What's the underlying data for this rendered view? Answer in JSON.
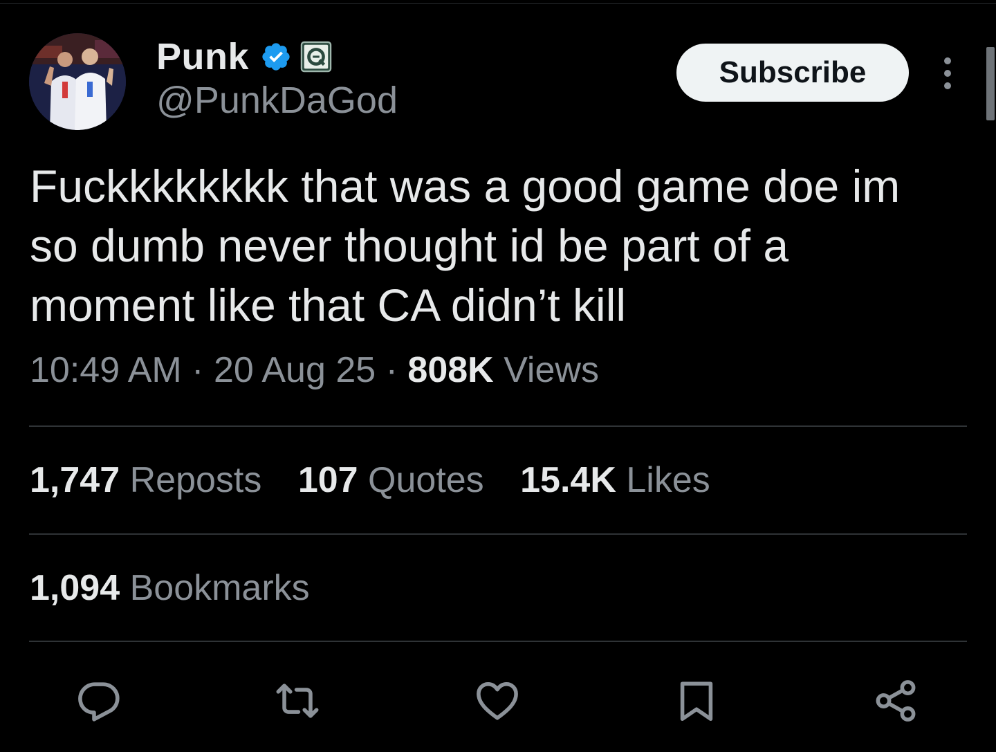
{
  "author": {
    "display_name": "Punk",
    "handle": "@PunkDaGod"
  },
  "header": {
    "subscribe_label": "Subscribe"
  },
  "tweet": {
    "text": "Fuckkkkkkkk that was a good game doe im so dumb never thought id be part of a moment like that CA didn’t kill",
    "time": "10:49 AM",
    "date": "20 Aug 25",
    "views_count": "808K",
    "views_label": "Views",
    "separator": "·"
  },
  "stats": {
    "reposts_count": "1,747",
    "reposts_label": "Reposts",
    "quotes_count": "107",
    "quotes_label": "Quotes",
    "likes_count": "15.4K",
    "likes_label": "Likes",
    "bookmarks_count": "1,094",
    "bookmarks_label": "Bookmarks"
  },
  "colors": {
    "background": "#000000",
    "text_primary": "#e7e9ea",
    "text_secondary": "#8b9198",
    "verified_blue": "#1d9bf0",
    "divider": "#2f3336"
  },
  "icons": {
    "verified": "verified-badge-icon",
    "affiliate": "affiliate-badge-icon",
    "more": "more-vertical-icon",
    "reply": "reply-icon",
    "repost": "repost-icon",
    "like": "heart-icon",
    "bookmark": "bookmark-icon",
    "share": "share-icon"
  }
}
